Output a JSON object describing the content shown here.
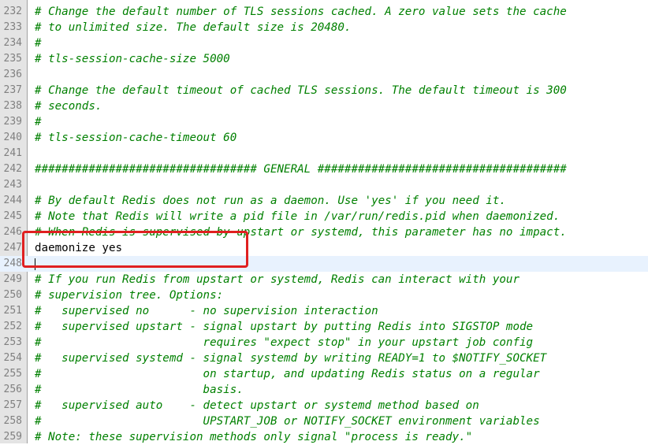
{
  "editor": {
    "lines": [
      {
        "num": "232",
        "text": "# Change the default number of TLS sessions cached. A zero value sets the cache",
        "kind": "comment"
      },
      {
        "num": "233",
        "text": "# to unlimited size. The default size is 20480.",
        "kind": "comment"
      },
      {
        "num": "234",
        "text": "#",
        "kind": "comment"
      },
      {
        "num": "235",
        "text": "# tls-session-cache-size 5000",
        "kind": "comment"
      },
      {
        "num": "236",
        "text": "",
        "kind": "comment"
      },
      {
        "num": "237",
        "text": "# Change the default timeout of cached TLS sessions. The default timeout is 300",
        "kind": "comment"
      },
      {
        "num": "238",
        "text": "# seconds.",
        "kind": "comment"
      },
      {
        "num": "239",
        "text": "#",
        "kind": "comment"
      },
      {
        "num": "240",
        "text": "# tls-session-cache-timeout 60",
        "kind": "comment"
      },
      {
        "num": "241",
        "text": "",
        "kind": "comment"
      },
      {
        "num": "242",
        "text": "################################# GENERAL #####################################",
        "kind": "comment"
      },
      {
        "num": "243",
        "text": "",
        "kind": "comment"
      },
      {
        "num": "244",
        "text": "# By default Redis does not run as a daemon. Use 'yes' if you need it.",
        "kind": "comment"
      },
      {
        "num": "245",
        "text": "# Note that Redis will write a pid file in /var/run/redis.pid when daemonized.",
        "kind": "comment"
      },
      {
        "num": "246",
        "text": "# When Redis is supervised by upstart or systemd, this parameter has no impact.",
        "kind": "comment"
      },
      {
        "num": "247",
        "text": "daemonize yes",
        "kind": "plain"
      },
      {
        "num": "248",
        "text": "",
        "kind": "plain"
      },
      {
        "num": "249",
        "text": "# If you run Redis from upstart or systemd, Redis can interact with your",
        "kind": "comment"
      },
      {
        "num": "250",
        "text": "# supervision tree. Options:",
        "kind": "comment"
      },
      {
        "num": "251",
        "text": "#   supervised no      - no supervision interaction",
        "kind": "comment"
      },
      {
        "num": "252",
        "text": "#   supervised upstart - signal upstart by putting Redis into SIGSTOP mode",
        "kind": "comment"
      },
      {
        "num": "253",
        "text": "#                        requires \"expect stop\" in your upstart job config",
        "kind": "comment"
      },
      {
        "num": "254",
        "text": "#   supervised systemd - signal systemd by writing READY=1 to $NOTIFY_SOCKET",
        "kind": "comment"
      },
      {
        "num": "255",
        "text": "#                        on startup, and updating Redis status on a regular",
        "kind": "comment"
      },
      {
        "num": "256",
        "text": "#                        basis.",
        "kind": "comment"
      },
      {
        "num": "257",
        "text": "#   supervised auto    - detect upstart or systemd method based on",
        "kind": "comment"
      },
      {
        "num": "258",
        "text": "#                        UPSTART_JOB or NOTIFY_SOCKET environment variables",
        "kind": "comment"
      },
      {
        "num": "259",
        "text": "# Note: these supervision methods only signal \"process is ready.\"",
        "kind": "comment"
      }
    ],
    "current_line": "248",
    "colors": {
      "comment": "#008000",
      "plain": "#000000",
      "line_number": "#808080",
      "current_line_bg": "#e8f2fe",
      "highlight_box": "#e02020"
    }
  }
}
